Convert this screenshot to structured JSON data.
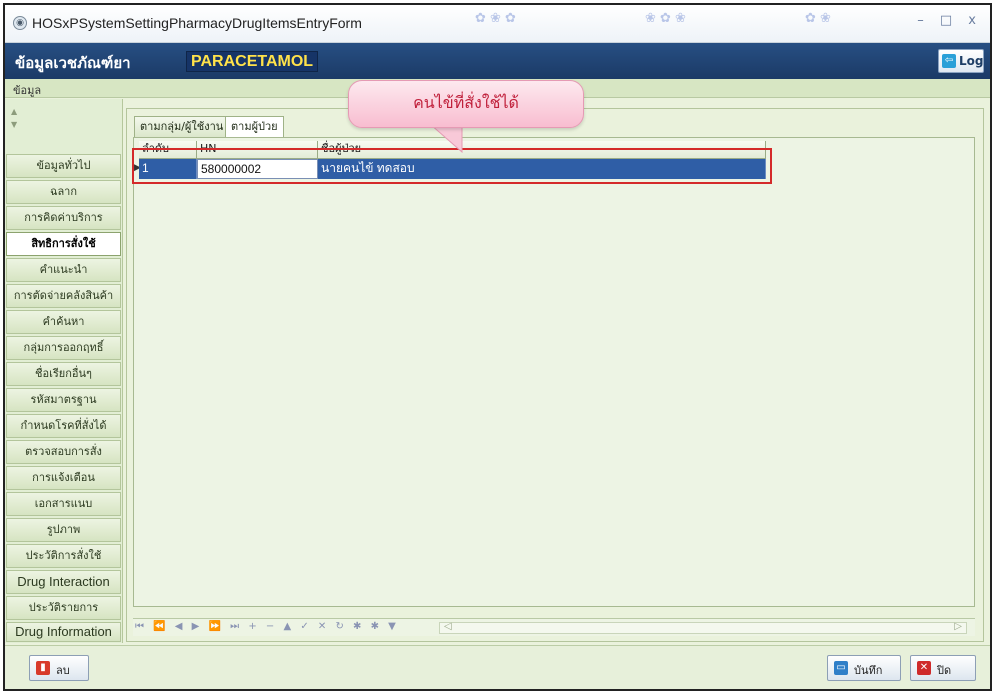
{
  "window": {
    "title": "HOSxPSystemSettingPharmacyDrugItemsEntryForm",
    "controls": "–  □  x"
  },
  "header": {
    "label": "ข้อมูลเวชภัณฑ์ยา",
    "drug_name": "PARACETAMOL",
    "log_button": "Log"
  },
  "section": {
    "label": "ข้อมูล"
  },
  "sidebar": {
    "items": [
      {
        "label": "ข้อมูลทั่วไป"
      },
      {
        "label": "ฉลาก"
      },
      {
        "label": "การคิดค่าบริการ"
      },
      {
        "label": "สิทธิการสั่งใช้",
        "active": true
      },
      {
        "label": "คำแนะนำ"
      },
      {
        "label": "การตัดจ่ายคลังสินค้า"
      },
      {
        "label": "คำค้นหา"
      },
      {
        "label": "กลุ่มการออกฤทธิ์"
      },
      {
        "label": "ชื่อเรียกอื่นๆ"
      },
      {
        "label": "รหัสมาตรฐาน"
      },
      {
        "label": "กำหนดโรคที่สั่งได้"
      },
      {
        "label": "ตรวจสอบการสั่ง"
      },
      {
        "label": "การแจ้งเตือน"
      },
      {
        "label": "เอกสารแนบ"
      },
      {
        "label": "รูปภาพ"
      },
      {
        "label": "ประวัติการสั่งใช้"
      },
      {
        "label": "Drug Interaction"
      },
      {
        "label": "ประวัติรายการ"
      },
      {
        "label": "Drug Information"
      }
    ]
  },
  "tabs": [
    {
      "label": "ตามกลุ่ม/ผู้ใช้งาน"
    },
    {
      "label": "ตามผู้ป่วย",
      "active": true
    }
  ],
  "grid": {
    "columns": [
      "ลำดับ",
      "HN",
      "ชื่อผู้ป่วย"
    ],
    "rows": [
      {
        "no": "1",
        "hn": "580000002",
        "name": "นายคนไข้ ทดสอบ"
      }
    ]
  },
  "callout": {
    "text": "คนไข้ที่สั่งใช้ได้"
  },
  "navigator": {
    "icons": "⏮ ⏪ ◀ ▶ ⏩ ⏭ + − ▲ ✓ ✕ ↻ ✱ ✱ ▼"
  },
  "buttons": {
    "delete": "ลบ",
    "save": "บันทึก",
    "close": "ปิด"
  },
  "colors": {
    "header_bg": "#1b3a66",
    "drug_name": "#ffe24a",
    "selected_row": "#2f5ea6",
    "highlight_border": "#d42a2a",
    "callout_text": "#c0203b"
  }
}
